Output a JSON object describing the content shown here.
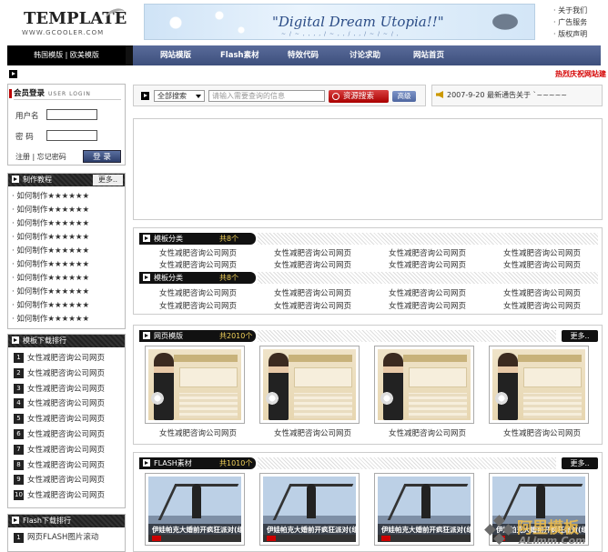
{
  "logo": {
    "title": "TEMPLATE",
    "sub": "WWW.GCOOLER.COM"
  },
  "banner": {
    "title": "\"Digital Dream Utopia!!\"",
    "sub": "~ / ~ , , , , / ~ , , / , , / ~ / ~ / ,"
  },
  "top_links": [
    "· 关于我们",
    "· 广告服务",
    "· 版权声明"
  ],
  "nav": {
    "left": "韩国模版  |  欧美模版",
    "items": [
      "网站模版",
      "Flash素材",
      "特效代码",
      "讨论求助",
      "网站首页"
    ]
  },
  "hot_text": "热烈庆祝网站建",
  "login": {
    "title": "会员登录",
    "title_en": "USER LOGIN",
    "username_label": "用户名",
    "password_label": "密  码",
    "links": "注册 | 忘记密码",
    "button": "登 录"
  },
  "tutorials": {
    "title": "制作教程",
    "more": "更多..",
    "items": [
      "· 如何制作★★★★★★",
      "· 如何制作★★★★★★",
      "· 如何制作★★★★★★",
      "· 如何制作★★★★★★",
      "· 如何制作★★★★★★",
      "· 如何制作★★★★★★",
      "· 如何制作★★★★★★",
      "· 如何制作★★★★★★",
      "· 如何制作★★★★★★",
      "· 如何制作★★★★★★"
    ]
  },
  "rank": {
    "title": "模板下载排行",
    "items": [
      {
        "n": "1",
        "t": "女性减肥咨询公司网页"
      },
      {
        "n": "2",
        "t": "女性减肥咨询公司网页"
      },
      {
        "n": "3",
        "t": "女性减肥咨询公司网页"
      },
      {
        "n": "4",
        "t": "女性减肥咨询公司网页"
      },
      {
        "n": "5",
        "t": "女性减肥咨询公司网页"
      },
      {
        "n": "6",
        "t": "女性减肥咨询公司网页"
      },
      {
        "n": "7",
        "t": "女性减肥咨询公司网页"
      },
      {
        "n": "8",
        "t": "女性减肥咨询公司网页"
      },
      {
        "n": "9",
        "t": "女性减肥咨询公司网页"
      },
      {
        "n": "10",
        "t": "女性减肥咨询公司网页"
      }
    ]
  },
  "flash_rank": {
    "title": "Flash下载排行",
    "items": [
      {
        "n": "1",
        "t": "网页FLASH图片滚动"
      }
    ]
  },
  "search": {
    "select": "全部搜索",
    "placeholder": "请输入需要查询的信息",
    "button": "资源搜索",
    "advanced": "高级"
  },
  "notice": "2007-9-20  最新通告关于 `~~~~~",
  "categories": [
    {
      "title": "模板分类",
      "count": "共8个",
      "rows": [
        [
          "女性减肥咨询公司网页",
          "女性减肥咨询公司网页",
          "女性减肥咨询公司网页",
          "女性减肥咨询公司网页"
        ],
        [
          "女性减肥咨询公司网页",
          "女性减肥咨询公司网页",
          "女性减肥咨询公司网页",
          "女性减肥咨询公司网页"
        ]
      ]
    },
    {
      "title": "模板分类",
      "count": "共8个",
      "rows": [
        [
          "女性减肥咨询公司网页",
          "女性减肥咨询公司网页",
          "女性减肥咨询公司网页",
          "女性减肥咨询公司网页"
        ],
        [
          "女性减肥咨询公司网页",
          "女性减肥咨询公司网页",
          "女性减肥咨询公司网页",
          "女性减肥咨询公司网页"
        ]
      ]
    }
  ],
  "web_templates": {
    "title": "网页模版",
    "count": "共2010个",
    "more": "更多..",
    "items": [
      "女性减肥咨询公司网页",
      "女性减肥咨询公司网页",
      "女性减肥咨询公司网页",
      "女性减肥咨询公司网页"
    ]
  },
  "flash_section": {
    "title": "FLASH素材",
    "count": "共1010个",
    "more": "更多..",
    "items": [
      "伊娃帕克大婚前开疯狂派对(组",
      "伊娃帕克大婚前开疯狂派对(组",
      "伊娃帕克大婚前开疯狂派对(组",
      "伊娃帕克大婚前开疯狂派对(组"
    ]
  },
  "watermark": {
    "cn": "阿里模板",
    "en": "ALimm.Com"
  }
}
